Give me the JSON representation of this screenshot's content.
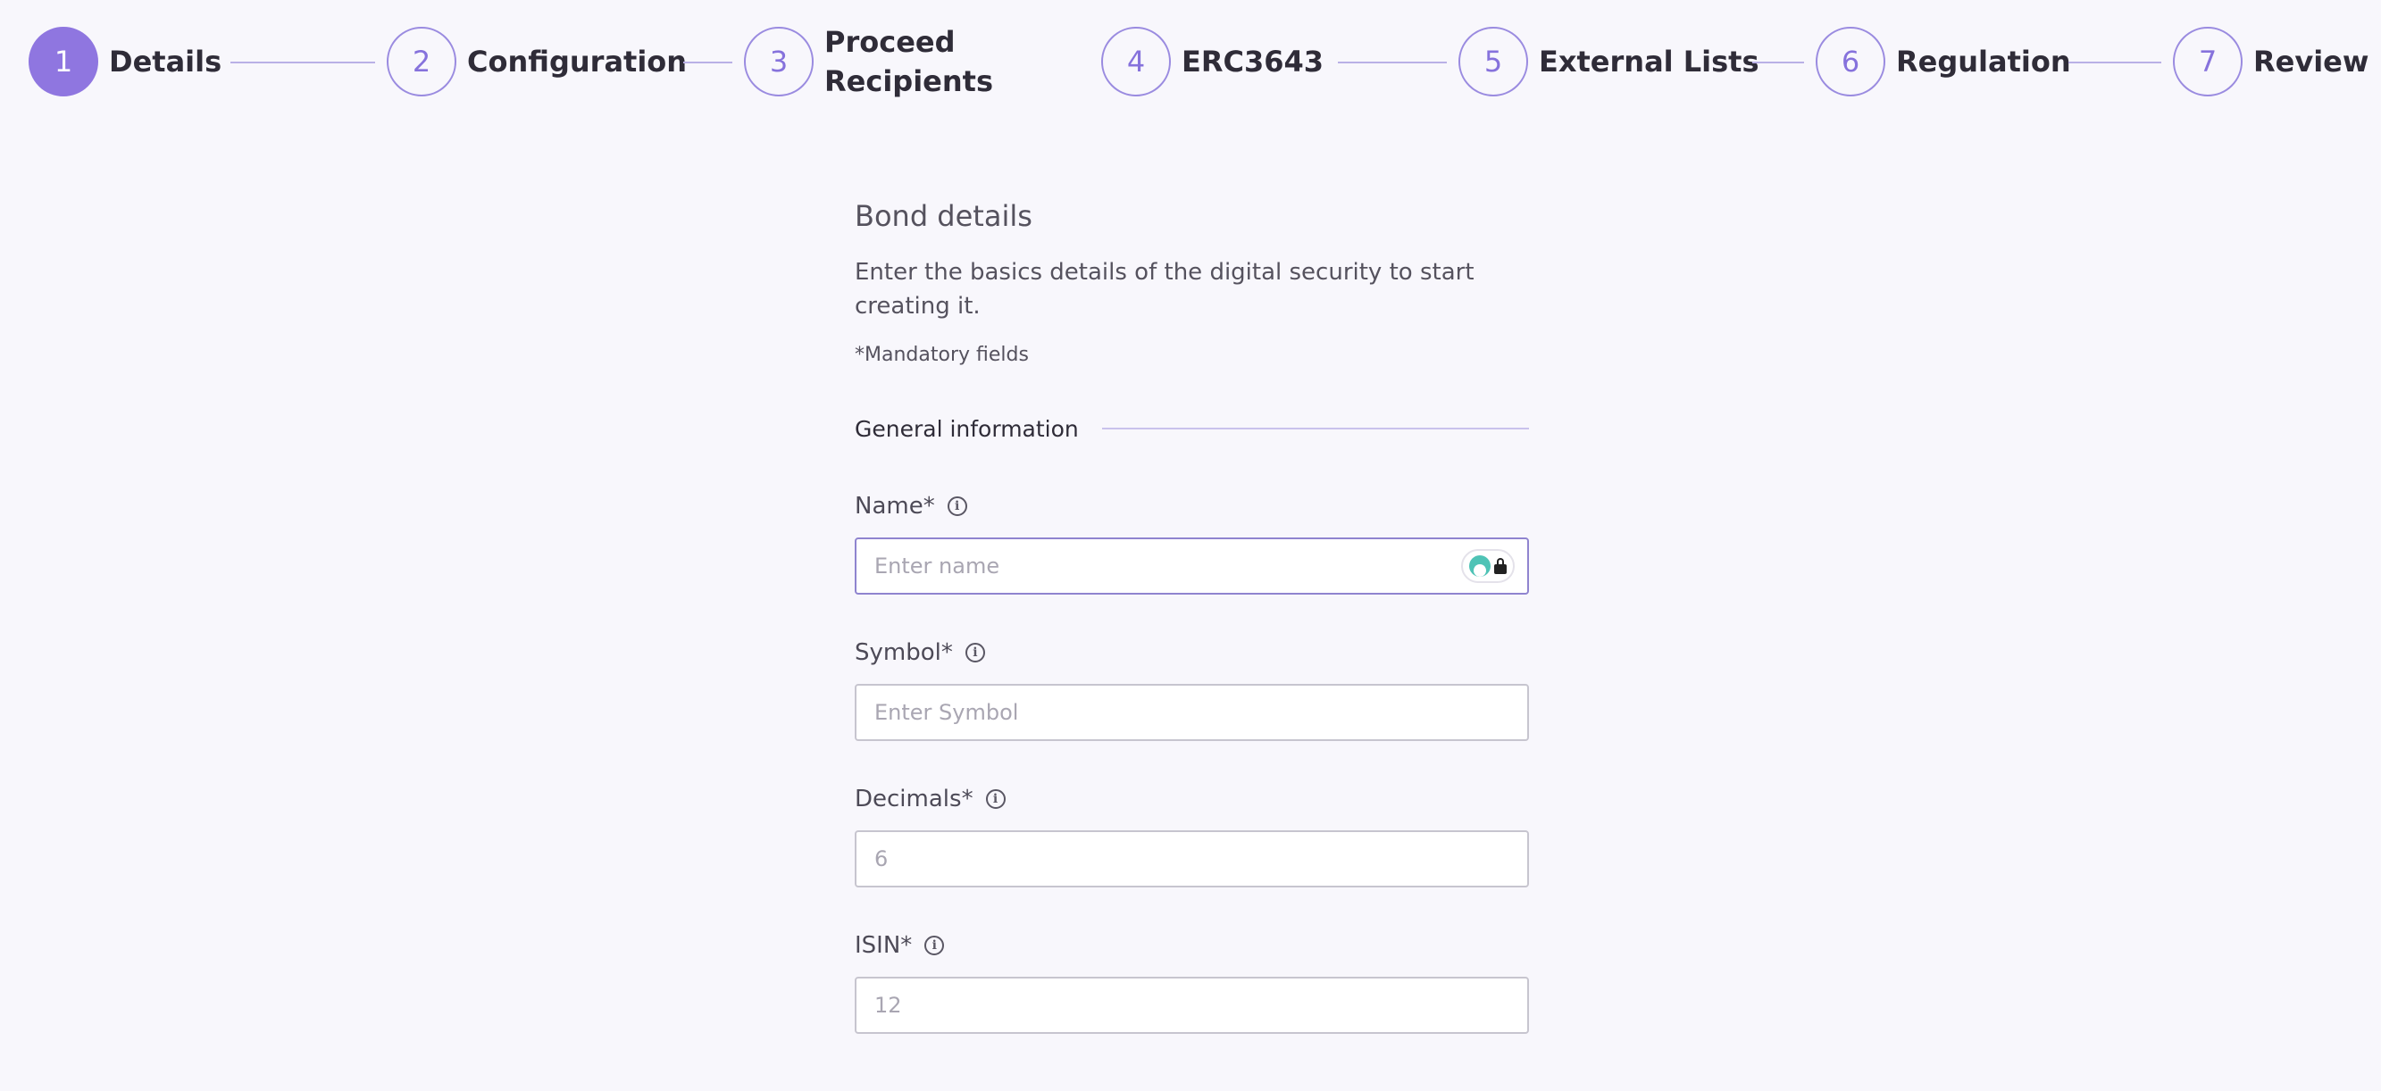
{
  "stepper": {
    "steps": [
      {
        "number": "1",
        "label": "Details"
      },
      {
        "number": "2",
        "label": "Configuration"
      },
      {
        "number": "3",
        "label": "Proceed Recipients"
      },
      {
        "number": "4",
        "label": "ERC3643"
      },
      {
        "number": "5",
        "label": "External Lists"
      },
      {
        "number": "6",
        "label": "Regulation"
      },
      {
        "number": "7",
        "label": "Review"
      }
    ],
    "active_step": "1"
  },
  "form": {
    "title": "Bond details",
    "description": "Enter the basics details of the digital security to start creating it.",
    "mandatory_note": "*Mandatory fields",
    "section_title": "General information",
    "info_glyph": "i",
    "fields": [
      {
        "label": "Name*",
        "placeholder": "Enter name",
        "value": ""
      },
      {
        "label": "Symbol*",
        "placeholder": "Enter Symbol",
        "value": ""
      },
      {
        "label": "Decimals*",
        "placeholder": "6",
        "value": ""
      },
      {
        "label": "ISIN*",
        "placeholder": "12",
        "value": ""
      }
    ]
  },
  "icons": {
    "info": "info-circle-icon",
    "password_manager": "password-manager-lock-icon"
  },
  "colors": {
    "accent": "#8f76e0",
    "background": "#f8f7fc",
    "focus_border": "#8f84cf"
  }
}
